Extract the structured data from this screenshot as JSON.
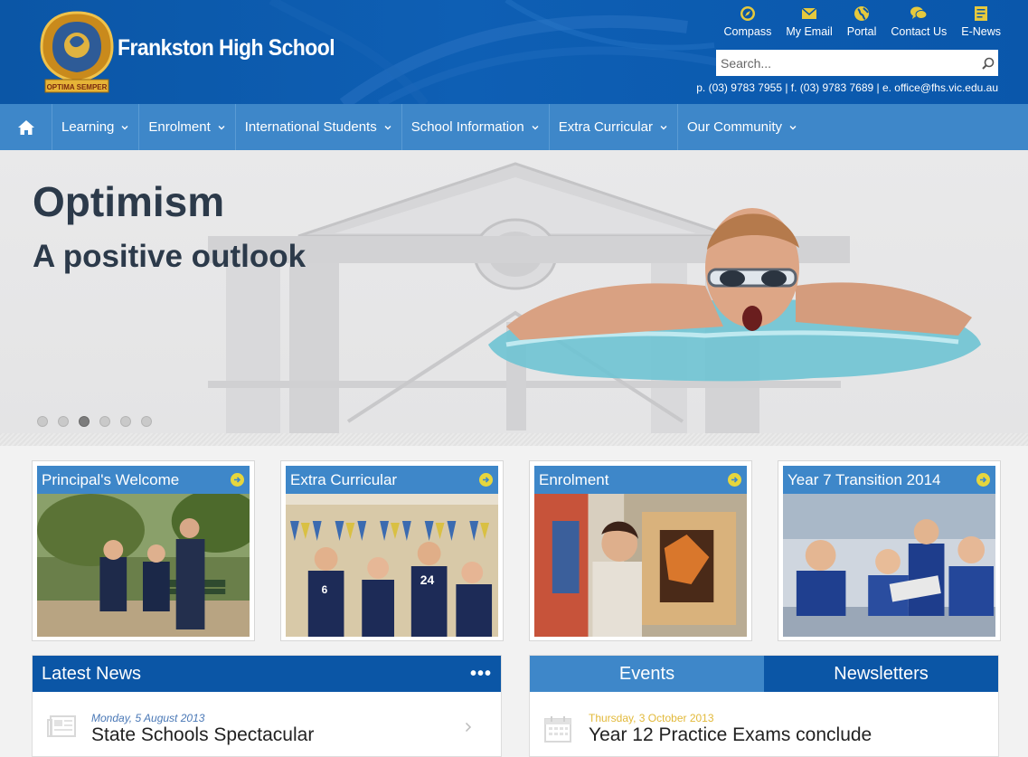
{
  "header": {
    "school_name": "Frankston High School",
    "logo_text_top": "FRANKSTON HIGH SCHOOL",
    "logo_motto": "OPTIMA SEMPER",
    "quick_links": [
      {
        "label": "Compass",
        "icon": "compass-icon"
      },
      {
        "label": "My Email",
        "icon": "envelope-icon"
      },
      {
        "label": "Portal",
        "icon": "globe-icon"
      },
      {
        "label": "Contact Us",
        "icon": "chat-bubbles-icon"
      },
      {
        "label": "E-News",
        "icon": "newsletter-icon"
      }
    ],
    "search_placeholder": "Search...",
    "contact_line": "p. (03) 9783 7955 | f. (03) 9783 7689 | e. office@fhs.vic.edu.au"
  },
  "nav": {
    "home_icon": "home-icon",
    "items": [
      "Learning",
      "Enrolment",
      "International Students",
      "School Information",
      "Extra Curricular",
      "Our Community"
    ]
  },
  "hero": {
    "title": "Optimism",
    "subtitle": "A positive outlook",
    "slide_count": 6,
    "active_slide": 3
  },
  "tiles": [
    {
      "title": "Principal's Welcome"
    },
    {
      "title": "Extra Curricular"
    },
    {
      "title": "Enrolment"
    },
    {
      "title": "Year 7 Transition 2014"
    }
  ],
  "news": {
    "heading": "Latest News",
    "more": "•••",
    "item": {
      "date": "Monday, 5 August 2013",
      "title": "State Schools Spectacular"
    }
  },
  "events": {
    "tabs": [
      "Events",
      "Newsletters"
    ],
    "item": {
      "date": "Thursday, 3 October 2013",
      "title": "Year 12 Practice Exams conclude"
    }
  },
  "colors": {
    "header_blue": "#0b56a6",
    "nav_blue": "#3e87c9",
    "accent_yellow": "#e6d63d",
    "heading_dark": "#2c3a4a"
  }
}
